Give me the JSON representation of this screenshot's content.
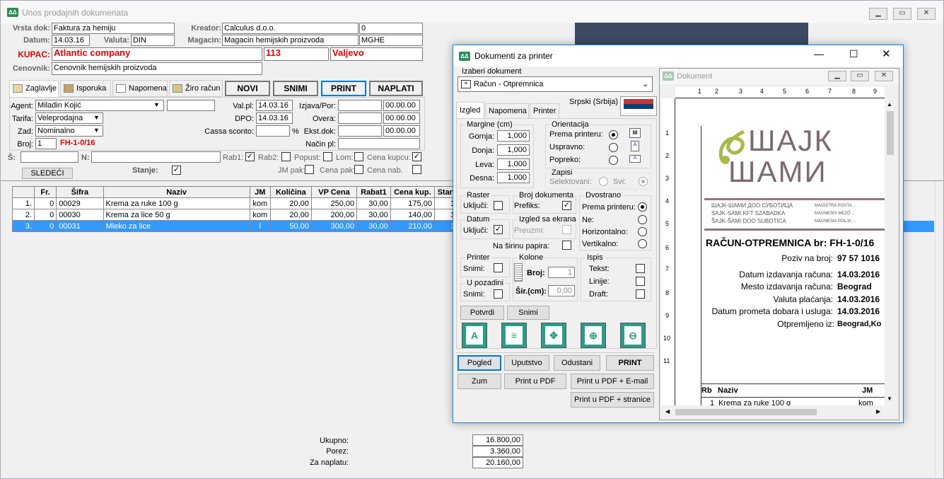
{
  "main": {
    "title": "Unos prodajnih dokumenata",
    "icon": "app-logo-icon",
    "header": {
      "vrsta_dok_label": "Vrsta dok:",
      "vrsta_dok": "Faktura za hemiju",
      "kreator_label": "Kreator:",
      "kreator": "Calculus d.o.o.",
      "kreator_code": "0",
      "datum_label": "Datum:",
      "datum": "14.03.16",
      "valuta_label": "Valuta:",
      "valuta": "DIN",
      "magacin_label": "Magacin:",
      "magacin": "Magacin hemijskih proizvoda",
      "magacin_code": "MGHE",
      "kupac_label": "KUPAC:",
      "kupac": "Atlantic company",
      "kupac_code": "113",
      "kupac_city": "Valjevo",
      "cenovnik_label": "Cenovnik:",
      "cenovnik": "Cenovnik hemijskih proizvoda"
    },
    "tabs": [
      "Zaglavlje",
      "Isporuka",
      "Napomena",
      "Žiro račun"
    ],
    "actions": [
      "NOVI",
      "SNIMI",
      "PRINT",
      "NAPLATI"
    ],
    "form": {
      "agent_label": "Agent:",
      "agent": "Miladin Kojić",
      "tarifa_label": "Tarifa:",
      "tarifa": "Veleprodajna",
      "zad_label": "Zad:",
      "zad": "Nominalno",
      "broj_label": "Broj:",
      "broj": "1",
      "broj_doc": "FH-1-0/16",
      "valpl_label": "Val.pl:",
      "valpl": "14.03.16",
      "dpo_label": "DPO:",
      "dpo": "14.03.16",
      "cassa_label": "Cassa sconto:",
      "pct": "%",
      "izjava_label": "Izjava/Por:",
      "overa_label": "Overa:",
      "ekst_label": "Ekst.dok:",
      "nacin_label": "Način pl:",
      "t1": "00.00.00",
      "t2": "00.00.00",
      "t3": "00.00.00"
    },
    "filters": {
      "s_label": "Š:",
      "n_label": "N:",
      "sledeci": "SLEDEĆI",
      "stanje": "Stanje:",
      "rab1": "Rab1:",
      "rab2": "Rab2:",
      "popust": "Popust:",
      "lom": "Lom:",
      "cena_kupcu": "Cena kupcu:",
      "jm_pak": "JM pak:",
      "cena_pak": "Cena pak:",
      "cena_nab": "Cena nab."
    },
    "table": {
      "columns": [
        "",
        "Fr.",
        "Šifra",
        "Naziv",
        "JM",
        "Količina",
        "VP Cena",
        "Rabat1",
        "Cena kup.",
        "Stan"
      ],
      "rows": [
        [
          "1.",
          "0",
          "00029",
          "Krema za ruke 100 g",
          "kom",
          "20,00",
          "250,00",
          "30,00",
          "175,00",
          "1"
        ],
        [
          "2.",
          "0",
          "00030",
          "Krema za lice 50 g",
          "kom",
          "20,00",
          "200,00",
          "30,00",
          "140,00",
          "1"
        ],
        [
          "3.",
          "0",
          "00031",
          "Mleko za lice",
          "l",
          "50,00",
          "300,00",
          "30,00",
          "210,00",
          "1"
        ]
      ]
    },
    "totals": {
      "ukupno_label": "Ukupno:",
      "ukupno": "16.800,00",
      "porez_label": "Porez:",
      "porez": "3.360,00",
      "naplata_label": "Za naplatu:",
      "naplata": "20.160,00"
    }
  },
  "dialog": {
    "title": "Dokumenti za printer",
    "izaberi_label": "Izaberi dokument",
    "izaberi": "Račun - Otpremnica",
    "language": "Srpski (Srbija)",
    "tabs": [
      "Izgled",
      "Napomena",
      "Printer"
    ],
    "margins": {
      "title": "Margine (cm)",
      "gornja": "Gornja:",
      "gornja_v": "1,000",
      "donja": "Donja:",
      "donja_v": "1,000",
      "leva": "Leva:",
      "leva_v": "1,000",
      "desna": "Desna:",
      "desna_v": "1,000"
    },
    "orientacija": {
      "title": "Orientacija",
      "prema": "Prema printeru:",
      "uspravno": "Uspravno:",
      "popreko": "Popreko:"
    },
    "zapisi": {
      "title": "Zapisi",
      "selektovani": "Selektovani:",
      "svi": "Svi:"
    },
    "raster": {
      "title": "Raster",
      "ukljuci": "Uključi:"
    },
    "broj_dok": {
      "title": "Broj dokumenta",
      "prefiks": "Prefiks:"
    },
    "dvostrano": {
      "title": "Dvostrano",
      "prema": "Prema printeru:",
      "ne": "Ne:",
      "horiz": "Horizontalno:",
      "vert": "Vertikalno:"
    },
    "datum": {
      "title": "Datum",
      "ukljuci": "Uključi:"
    },
    "izgled_ekrana": {
      "title": "Izgled sa ekrana",
      "preuzmi": "Preuzmi:"
    },
    "sirina": "Na širinu papira:",
    "printer": {
      "title": "Printer",
      "snimi": "Snimi:"
    },
    "pozadini": {
      "title": "U pozadini",
      "snimi": "Snimi:"
    },
    "kolone": {
      "title": "Kolone",
      "broj": "Broj:",
      "broj_v": "1",
      "sir": "Šir.(cm):",
      "sir_v": "0,00"
    },
    "ispis": {
      "title": "Ispis",
      "tekst": "Tekst:",
      "linije": "Linije:",
      "draft": "Draft:"
    },
    "potvrdi": "Potvrdi",
    "snimi": "Snimi",
    "buttons": [
      "Pogled",
      "Uputstvo",
      "Odustani",
      "PRINT",
      "Zum",
      "Print u PDF",
      "Print u PDF + E-mail",
      "Print u PDF + stranice"
    ]
  },
  "preview": {
    "title": "Dokument",
    "logo_line1": "ШАЈК",
    "logo_line2": "ШАМИ",
    "company_lines": [
      "ШАЈК-ШАМИ ДОО СУБОТИЦА",
      "SAJK-SAMI KFT SZABADKA",
      "ŠAJK-ŠAMI DOO SUBOTICA"
    ],
    "company_lines2": [
      "MAGISTRA POSTA ...",
      "MAGNESIS MEZŐ ...",
      "MAGNESIA POLJA ..."
    ],
    "doc_title": "RAČUN-OTPREMNICA br: FH-1-0/16",
    "fields": [
      [
        "Poziv na broj:",
        "97 57  1016"
      ],
      [
        "Datum izdavanja računa:",
        "14.03.2016"
      ],
      [
        "Mesto izdavanja računa:",
        "Beograd"
      ],
      [
        "Valuta plaćanja:",
        "14.03.2016"
      ],
      [
        "Datum prometa dobara i usluga:",
        "14.03.2016"
      ],
      [
        "Otpremljeno iz:",
        "Beograd,Ko"
      ]
    ],
    "table_head": [
      "Rb",
      "Naziv",
      "JM"
    ],
    "table_row": [
      "1",
      "Krema za ruke 100 g",
      "kom"
    ],
    "ruler_marks": [
      "1",
      "2",
      "3",
      "4",
      "5",
      "6",
      "7",
      "8",
      "9",
      "10",
      "11"
    ]
  },
  "colors": {
    "accent": "#0078d7",
    "red": "#e00000",
    "selected_row": "#3399ff"
  }
}
